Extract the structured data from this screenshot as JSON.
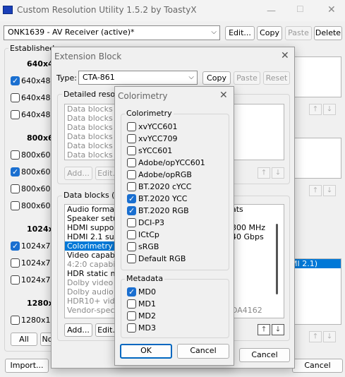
{
  "main": {
    "title": "Custom Resolution Utility 1.5.2 by ToastyX",
    "monitor": "ONK1639 - AV Receiver (active)*",
    "edit_btn": "Edit...",
    "copy_btn": "Copy",
    "paste_btn": "Paste",
    "delete_btn": "Delete",
    "established_label": "Established",
    "groups": [
      {
        "label": "640x48",
        "items": [
          {
            "text": "640x480",
            "checked": true
          },
          {
            "text": "640x480",
            "checked": false
          },
          {
            "text": "640x480",
            "checked": false
          }
        ]
      },
      {
        "label": "800x60",
        "items": [
          {
            "text": "800x600",
            "checked": false
          },
          {
            "text": "800x600",
            "checked": true
          },
          {
            "text": "800x600",
            "checked": false
          },
          {
            "text": "800x600",
            "checked": false
          }
        ]
      },
      {
        "label": "1024x7",
        "items": [
          {
            "text": "1024x76",
            "checked": true
          },
          {
            "text": "1024x76",
            "checked": false
          },
          {
            "text": "1024x76",
            "checked": false
          }
        ]
      },
      {
        "label": "1280x1",
        "items": [
          {
            "text": "1280x10",
            "checked": false
          }
        ]
      }
    ],
    "all_btn": "All",
    "none_btn": "No",
    "import_btn": "Import...",
    "cancel_btn": "Cancel",
    "right_panel_text": "MI 2.1)"
  },
  "ext": {
    "title": "Extension Block",
    "type_label": "Type:",
    "type_value": "CTA-861",
    "copy_btn": "Copy",
    "paste_btn": "Paste",
    "reset_btn": "Reset",
    "detailed_label": "Detailed resolu",
    "detailed_items": [
      "Data blocks (1",
      "Data blocks (1",
      "Data blocks (1",
      "Data blocks (1",
      "Data blocks (1",
      "Data blocks (1"
    ],
    "add_btn": "Add...",
    "edit_btn": "Edit...",
    "datablocks_label": "Data blocks (5",
    "datablocks_items": [
      {
        "text": "Audio formats",
        "right": "ats",
        "state": "normal"
      },
      {
        "text": "Speaker setup",
        "right": "",
        "state": "normal"
      },
      {
        "text": "HDMI support",
        "right": "300 MHz",
        "state": "normal"
      },
      {
        "text": "HDMI 2.1 supp",
        "right": "40 Gbps",
        "state": "normal"
      },
      {
        "text": "Colorimetry",
        "right": "",
        "state": "selected"
      },
      {
        "text": "Video capabilit",
        "right": "",
        "state": "normal"
      },
      {
        "text": "4:2:0 capabilit",
        "right": "",
        "state": "gray"
      },
      {
        "text": "HDR static me",
        "right": "",
        "state": "normal"
      },
      {
        "text": "Dolby video",
        "right": "",
        "state": "gray"
      },
      {
        "text": "Dolby audio",
        "right": "",
        "state": "gray"
      },
      {
        "text": "HDR10+ video",
        "right": "",
        "state": "gray"
      },
      {
        "text": "Vendor-specifi",
        "right": "DA4162",
        "state": "gray"
      }
    ],
    "add2_btn": "Add...",
    "edit2_btn": "Edit...",
    "ok_btn": "",
    "cancel_btn": "Cancel"
  },
  "color": {
    "title": "Colorimetry",
    "group_label": "Colorimetry",
    "items": [
      {
        "text": "xvYCC601",
        "checked": false
      },
      {
        "text": "xvYCC709",
        "checked": false
      },
      {
        "text": "sYCC601",
        "checked": false
      },
      {
        "text": "Adobe/opYCC601",
        "checked": false
      },
      {
        "text": "Adobe/opRGB",
        "checked": false
      },
      {
        "text": "BT.2020 cYCC",
        "checked": false
      },
      {
        "text": "BT.2020 YCC",
        "checked": true
      },
      {
        "text": "BT.2020 RGB",
        "checked": true
      },
      {
        "text": "DCI-P3",
        "checked": false
      },
      {
        "text": "ICtCp",
        "checked": false
      },
      {
        "text": "sRGB",
        "checked": false
      },
      {
        "text": "Default RGB",
        "checked": false
      }
    ],
    "meta_label": "Metadata",
    "meta_items": [
      {
        "text": "MD0",
        "checked": true
      },
      {
        "text": "MD1",
        "checked": false
      },
      {
        "text": "MD2",
        "checked": false
      },
      {
        "text": "MD3",
        "checked": false
      }
    ],
    "ok_btn": "OK",
    "cancel_btn": "Cancel"
  },
  "colors": {
    "accent": "#0078d7",
    "check": "#1a6fd0"
  }
}
